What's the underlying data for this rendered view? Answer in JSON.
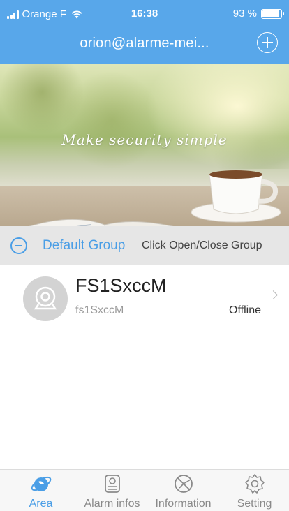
{
  "status_bar": {
    "carrier": "Orange F",
    "time": "16:38",
    "battery": "93 %",
    "battery_level": 0.93
  },
  "navbar": {
    "title": "orion@alarme-mei..."
  },
  "banner": {
    "slogan": "Make security simple"
  },
  "group": {
    "name": "Default Group",
    "hint": "Click Open/Close Group"
  },
  "devices": [
    {
      "name": "FS1SxccM",
      "id": "fs1SxccM",
      "status": "Offline"
    }
  ],
  "tabs": [
    {
      "label": "Area",
      "icon": "area-icon",
      "active": true
    },
    {
      "label": "Alarm infos",
      "icon": "alarm-infos-icon",
      "active": false
    },
    {
      "label": "Information",
      "icon": "information-icon",
      "active": false
    },
    {
      "label": "Setting",
      "icon": "setting-icon",
      "active": false
    }
  ],
  "colors": {
    "header": "#58a7ea",
    "accent": "#4a9ee6",
    "group_background": "#e6e6e6",
    "tab_inactive": "#8a8a8a"
  }
}
